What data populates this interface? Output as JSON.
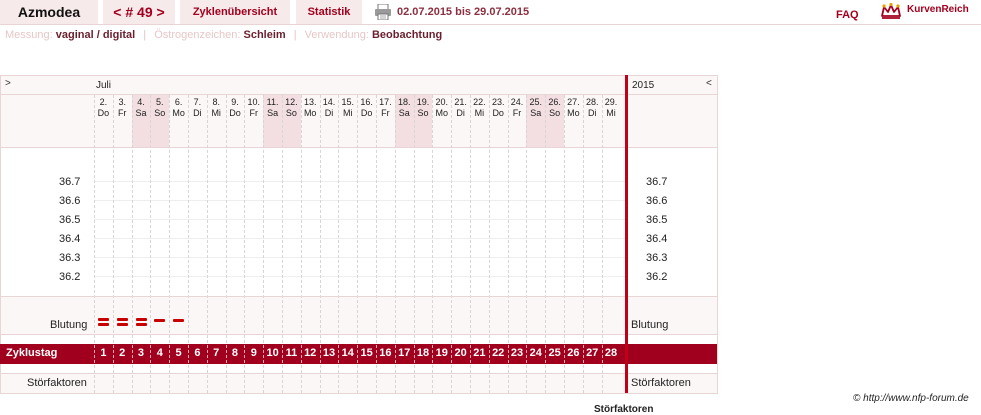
{
  "brand": "Azmodea",
  "cycle": {
    "prev": "<",
    "number": "# 49",
    "next": ">"
  },
  "tabs": {
    "overview": "Zyklenübersicht",
    "statistics": "Statistik"
  },
  "date_range": "02.07.2015 bis 29.07.2015",
  "faq": "FAQ",
  "logo_text": "KurvenReich",
  "meta": {
    "measurement_label": "Messung:",
    "measurement_value": "vaginal / digital",
    "estrogen_label": "Östrogenzeichen:",
    "estrogen_value": "Schleim",
    "usage_label": "Verwendung:",
    "usage_value": "Beobachtung"
  },
  "chart": {
    "left_toggle": ">",
    "right_toggle": "<",
    "month": "Juli",
    "year": "2015",
    "days": [
      {
        "d": "2.",
        "w": "Do"
      },
      {
        "d": "3.",
        "w": "Fr"
      },
      {
        "d": "4.",
        "w": "Sa"
      },
      {
        "d": "5.",
        "w": "So"
      },
      {
        "d": "6.",
        "w": "Mo"
      },
      {
        "d": "7.",
        "w": "Di"
      },
      {
        "d": "8.",
        "w": "Mi"
      },
      {
        "d": "9.",
        "w": "Do"
      },
      {
        "d": "10.",
        "w": "Fr"
      },
      {
        "d": "11.",
        "w": "Sa"
      },
      {
        "d": "12.",
        "w": "So"
      },
      {
        "d": "13.",
        "w": "Mo"
      },
      {
        "d": "14.",
        "w": "Di"
      },
      {
        "d": "15.",
        "w": "Mi"
      },
      {
        "d": "16.",
        "w": "Do"
      },
      {
        "d": "17.",
        "w": "Fr"
      },
      {
        "d": "18.",
        "w": "Sa"
      },
      {
        "d": "19.",
        "w": "So"
      },
      {
        "d": "20.",
        "w": "Mo"
      },
      {
        "d": "21.",
        "w": "Di"
      },
      {
        "d": "22.",
        "w": "Mi"
      },
      {
        "d": "23.",
        "w": "Do"
      },
      {
        "d": "24.",
        "w": "Fr"
      },
      {
        "d": "25.",
        "w": "Sa"
      },
      {
        "d": "26.",
        "w": "So"
      },
      {
        "d": "27.",
        "w": "Mo"
      },
      {
        "d": "28.",
        "w": "Di"
      },
      {
        "d": "29.",
        "w": "Mi"
      }
    ],
    "temperatures": [
      "36.7",
      "36.6",
      "36.5",
      "36.4",
      "36.3",
      "36.2"
    ],
    "bleeding_label": "Blutung",
    "bleeding": [
      {
        "day": 1,
        "level": "stark"
      },
      {
        "day": 2,
        "level": "stark"
      },
      {
        "day": 3,
        "level": "stark"
      },
      {
        "day": 4,
        "level": "schwach"
      },
      {
        "day": 5,
        "level": "schwach"
      }
    ],
    "cycle_day_label": "Zyklustag",
    "cycle_days": [
      "1",
      "2",
      "3",
      "4",
      "5",
      "6",
      "7",
      "8",
      "9",
      "10",
      "11",
      "12",
      "13",
      "14",
      "15",
      "16",
      "17",
      "18",
      "19",
      "20",
      "21",
      "22",
      "23",
      "24",
      "25",
      "26",
      "27",
      "28"
    ],
    "disturbance_label": "Störfaktoren"
  },
  "copyright": "© http://www.nfp-forum.de",
  "cut_text": "Störfaktoren"
}
